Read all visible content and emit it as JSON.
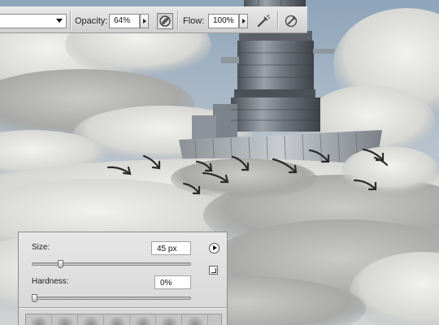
{
  "options_bar": {
    "mode_value": "",
    "opacity_label": "Opacity:",
    "opacity_value": "64%",
    "flow_label": "Flow:",
    "flow_value": "100%",
    "icons": [
      "dropdown-arrow-icon",
      "stepper-arrow-icon",
      "pressure-opacity-icon",
      "airbrush-icon",
      "pressure-size-icon"
    ]
  },
  "brush_panel": {
    "size_label": "Size:",
    "size_value": "45 px",
    "size_slider_fraction": 0.18,
    "hardness_label": "Hardness:",
    "hardness_value": "0%",
    "hardness_slider_fraction": 0.0,
    "icons": [
      "panel-menu-icon",
      "new-preset-icon"
    ]
  },
  "scene": {
    "description_icons": [
      "cloud-city-tower",
      "cloud-arrows"
    ],
    "colors": {
      "sky": "#a9b8c8",
      "cloud": "#d9d9d6",
      "tower": "#6e747c",
      "arrow": "#2b2b2b"
    }
  }
}
